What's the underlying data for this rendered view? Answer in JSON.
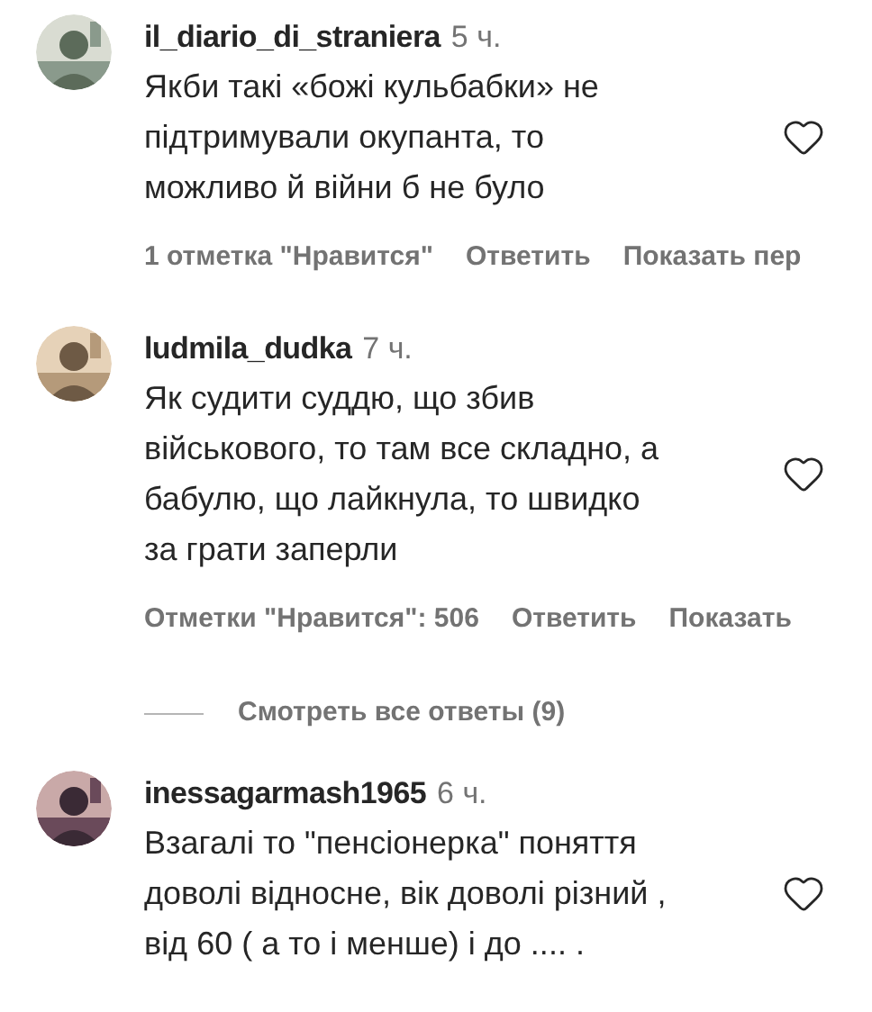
{
  "comments": [
    {
      "username": "il_diario_di_straniera",
      "time": "5 ч.",
      "lines": [
        "Якби такі «божі кульбабки» не",
        "підтримували окупанта, то",
        "можливо й війни б не було"
      ],
      "actions": [
        "1 отметка \"Нравится\"",
        "Ответить",
        "Показать пер"
      ]
    },
    {
      "username": "ludmila_dudka",
      "time": "7 ч.",
      "lines": [
        "Як судити суддю, що збив",
        "військового, то там все складно, а",
        "бабулю, що лайкнула, то швидко",
        "за грати заперли"
      ],
      "actions": [
        "Отметки \"Нравится\": 506",
        "Ответить",
        "Показать"
      ],
      "replies": "Смотреть все ответы (9)"
    },
    {
      "username": "inessagarmash1965",
      "time": "6 ч.",
      "lines": [
        "Взагалі то \"пенсіонерка\" поняття",
        "доволі відносне, вік доволі різний ,",
        "від 60 ( а то і менше) і до .... ."
      ]
    }
  ]
}
